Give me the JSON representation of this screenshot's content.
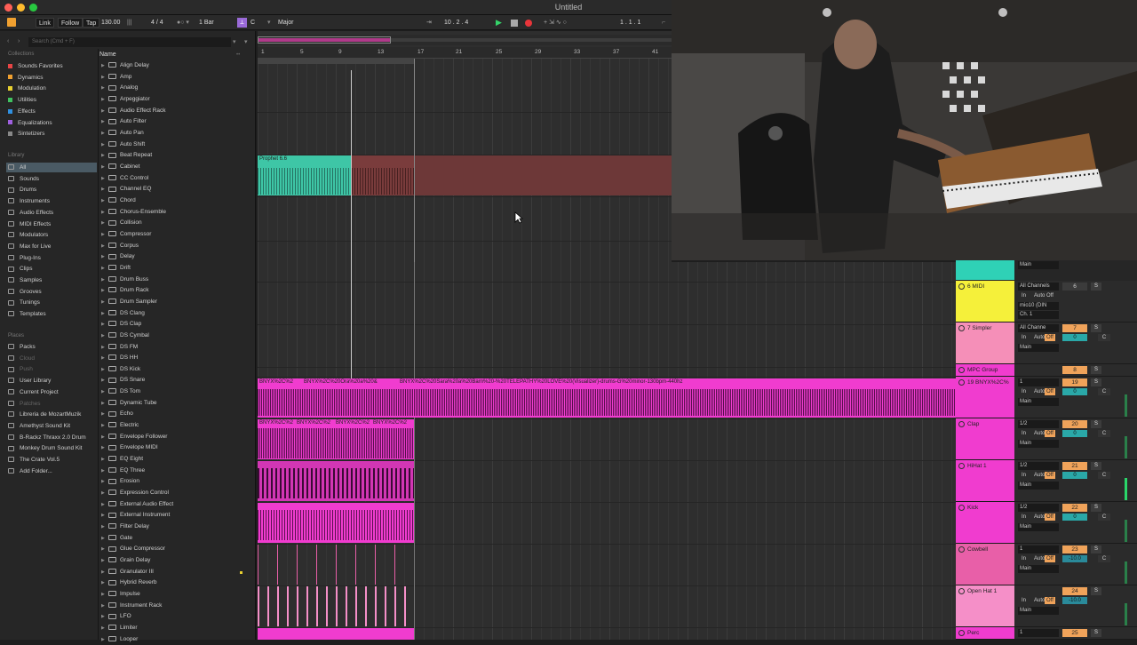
{
  "window": {
    "title": "Untitled"
  },
  "control_bar": {
    "link": "Link",
    "follow": "Follow",
    "tap": "Tap",
    "tempo": "130.00",
    "signature": "4 / 4",
    "quantize": "1 Bar",
    "key": "C",
    "scale": "Major",
    "position": "10 .  2 .  4",
    "loop_start": "1 .  1 .  1"
  },
  "browser": {
    "search_placeholder": "Search (Cmd + F)",
    "collections_header": "Collections",
    "collections": [
      {
        "label": "Sounds Favorites",
        "color": "#e84545"
      },
      {
        "label": "Dynamics",
        "color": "#f0a030"
      },
      {
        "label": "Modulation",
        "color": "#e8d030"
      },
      {
        "label": "Utilities",
        "color": "#40c060"
      },
      {
        "label": "Effects",
        "color": "#3090e0"
      },
      {
        "label": "Equalizations",
        "color": "#a060e0"
      },
      {
        "label": "Sintetizers",
        "color": "#888888"
      }
    ],
    "library_header": "Library",
    "library": [
      "All",
      "Sounds",
      "Drums",
      "Instruments",
      "Audio Effects",
      "MIDI Effects",
      "Modulators",
      "Max for Live",
      "Plug-Ins",
      "Clips",
      "Samples",
      "Grooves",
      "Tunings",
      "Templates"
    ],
    "places_header": "Places",
    "places": [
      "Packs",
      "Cloud",
      "Push",
      "User Library",
      "Current Project",
      "Patches",
      "Libreria de MozartMuzik",
      "Amethyst Sound Kit",
      "B-Rackz Thraxx 2.0 Drum",
      "Monkey Drum Sound Kit",
      "The Crate Vol.5",
      "Add Folder..."
    ],
    "column_header": "Name",
    "items": [
      "Align Delay",
      "Amp",
      "Analog",
      "Arpeggiator",
      "Audio Effect Rack",
      "Auto Filter",
      "Auto Pan",
      "Auto Shift",
      "Beat Repeat",
      "Cabinet",
      "CC Control",
      "Channel EQ",
      "Chord",
      "Chorus-Ensemble",
      "Collision",
      "Compressor",
      "Corpus",
      "Delay",
      "Drift",
      "Drum Buss",
      "Drum Rack",
      "Drum Sampler",
      "DS Clang",
      "DS Clap",
      "DS Cymbal",
      "DS FM",
      "DS HH",
      "DS Kick",
      "DS Snare",
      "DS Tom",
      "Dynamic Tube",
      "Echo",
      "Electric",
      "Envelope Follower",
      "Envelope MIDI",
      "EQ Eight",
      "EQ Three",
      "Erosion",
      "Expression Control",
      "External Audio Effect",
      "External Instrument",
      "Filter Delay",
      "Gate",
      "Glue Compressor",
      "Grain Delay",
      "Granulator III",
      "Hybrid Reverb",
      "Impulse",
      "Instrument Rack",
      "LFO",
      "Limiter",
      "Looper"
    ]
  },
  "ruler": [
    "1",
    "5",
    "9",
    "13",
    "17",
    "21",
    "25",
    "29",
    "33",
    "37",
    "41"
  ],
  "clips": {
    "prophet": "Prophet 6.6",
    "long_audio_1": "BNYX%2C%2",
    "long_audio_2": "BNYX%2C%20Ora%20a%20&",
    "long_audio_3": "BNYX%2C%20Sara%20a%20Barn%20-%20TELEPATHY%20LOVE%20(Visualizer)-drums-G%20minor-130bpm-440hz",
    "drum_1": "BNYX%2C%2",
    "drum_2": "BNYX%2C%2",
    "drum_3": "BNYX%2C%2",
    "drum_4": "BNYX%2C%2"
  },
  "mixer": {
    "top_output": "Main",
    "tracks": [
      {
        "name": "6 MIDI",
        "color": "#f5f03a",
        "input": "All Channels",
        "num": "6",
        "mon": [
          "In",
          "Auto",
          "Off"
        ],
        "out": "mio10 (DIN",
        "ch": "Ch. 1"
      },
      {
        "name": "7 Simpler",
        "color": "#f58fb8",
        "input": "All Channe",
        "num": "7",
        "vol": "0",
        "pan": "C",
        "out": "Main"
      },
      {
        "name": "MPC Group",
        "color": "#f03ccf",
        "num": "8"
      },
      {
        "name": "19 BNYX%2C%",
        "color": "#f03ccf",
        "input": "1",
        "num": "19",
        "vol": "0",
        "pan": "C",
        "out": "Main"
      },
      {
        "name": "Clap",
        "color": "#f03ccf",
        "input": "1/2",
        "num": "20",
        "vol": "0",
        "pan": "C",
        "out": "Main"
      },
      {
        "name": "HiHat 1",
        "color": "#f03ccf",
        "input": "1/2",
        "num": "21",
        "vol": "0",
        "pan": "C",
        "out": "Main"
      },
      {
        "name": "Kick",
        "color": "#f03ccf",
        "input": "1/2",
        "num": "22",
        "vol": "0",
        "pan": "C",
        "out": "Main"
      },
      {
        "name": "Cowbell",
        "color": "#e85fa8",
        "input": "1",
        "num": "23",
        "vol": "-10.0",
        "pan": "C",
        "out": "Main"
      },
      {
        "name": "Open Hat 1",
        "color": "#f58fc8",
        "num": "24",
        "vol": "-10.0",
        "out": "Main"
      },
      {
        "name": "Perc",
        "color": "#f03ccf",
        "input": "1",
        "num": "25"
      }
    ],
    "mon_labels": {
      "in": "In",
      "auto": "Auto",
      "off": "Off"
    },
    "solo": "S"
  }
}
